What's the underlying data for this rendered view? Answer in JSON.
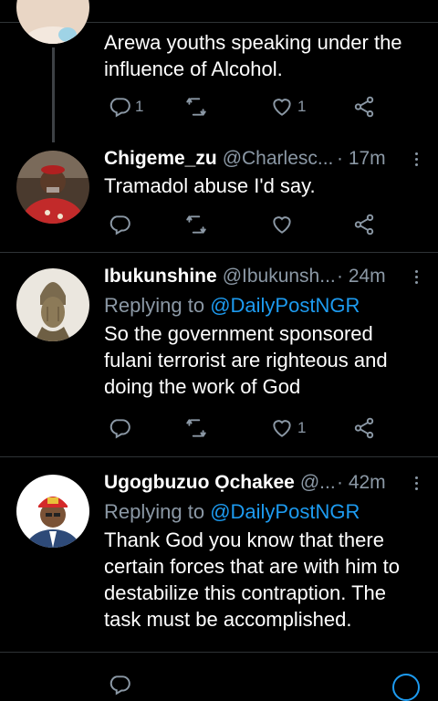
{
  "tweets": [
    {
      "text": "Arewa youths speaking under the influence of Alcohol.",
      "text_lines": [
        "Arewa youths speaking under the",
        "influence of Alcohol."
      ],
      "reply_count": "1",
      "like_count": "1"
    },
    {
      "name": "Chigeme_zu",
      "handle": "@Charlesc...",
      "time": "· 17m",
      "text": "Tramadol abuse I'd say."
    },
    {
      "name": "Ibukunshine",
      "handle": "@Ibukunsh...",
      "time": "· 24m",
      "replying_prefix": "Replying to",
      "replying_to": "@DailyPostNGR",
      "text_lines": [
        "So the government sponsored",
        "fulani terrorist are righteous and",
        "doing the work of God"
      ],
      "like_count": "1"
    },
    {
      "name": "Ugogbuzuo Ọchakee",
      "handle": "@...",
      "time": "· 42m",
      "replying_prefix": "Replying to",
      "replying_to": "@DailyPostNGR",
      "text_lines": [
        "Thank God you know that there",
        "certain forces that are with him to",
        "destabilize this contraption. The",
        "task must be accomplished."
      ]
    }
  ],
  "colors": {
    "background": "#000000",
    "secondary_text": "#8b98a5",
    "link": "#1d9bf0",
    "divider": "#2f3336"
  },
  "icons": [
    "reply-icon",
    "retweet-icon",
    "like-icon",
    "share-icon",
    "more-icon"
  ]
}
